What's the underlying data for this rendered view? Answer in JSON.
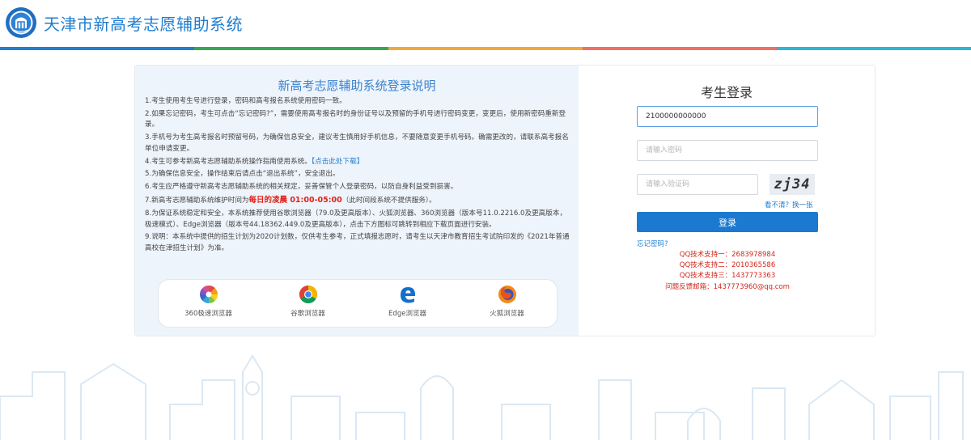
{
  "header": {
    "site_title": "天津市新高考志愿辅助系统",
    "stripe_colors": [
      "#1f7ed0",
      "#37a852",
      "#f0a93a",
      "#f26e63",
      "#2bb6d8"
    ]
  },
  "notice": {
    "title": "新高考志愿辅助系统登录说明",
    "items": [
      "1.考生使用考生号进行登录，密码和高考报名系统使用密码一致。",
      "2.如果忘记密码，考生可点击“忘记密码?”，需要使用高考报名时的身份证号以及预留的手机号进行密码变更，变更后，使用新密码重新登录。",
      "3.手机号为考生高考报名时预留号码，为确保信息安全，建议考生慎用好手机信息，不要随意变更手机号码。确需更改的，请联系高考报名单位申请变更。",
      "4.考生可参考新高考志愿辅助系统操作指南使用系统。",
      "5.为确保信息安全，操作结束后请点击“退出系统”，安全退出。",
      "6.考生应严格遵守新高考志愿辅助系统的相关规定，妥善保管个人登录密码，以防自身利益受到损害。",
      "7.新高考志愿辅助系统维护时间为",
      "8.为保证系统稳定和安全，本系统推荐使用谷歌浏览器（79.0及更高版本）、火狐浏览器、360浏览器（版本号11.0.2216.0及更高版本，极速模式）、Edge浏览器（版本号44.18362.449.0及更高版本），点击下方图标可跳转到相应下载页面进行安装。",
      "9.说明：本系统中提供的招生计划为2020计划数，仅供考生参考，正式填报志愿时，请考生以天津市教育招生考试院印发的《2021年普通高校在津招生计划》为准。"
    ],
    "guide_link": "【点击此处下载】",
    "maintenance_time": "每日的凌晨 01:00-05:00",
    "maintenance_note": "（此时间段系统不提供服务）。"
  },
  "browsers": [
    {
      "label": "360极速浏览器",
      "icon": "browser-360-icon"
    },
    {
      "label": "谷歌浏览器",
      "icon": "chrome-icon"
    },
    {
      "label": "Edge浏览器",
      "icon": "edge-icon"
    },
    {
      "label": "火狐浏览器",
      "icon": "firefox-icon"
    }
  ],
  "login": {
    "title": "考生登录",
    "username_value": "2100000000000",
    "password_placeholder": "请输入密码",
    "captcha_placeholder": "请输入验证码",
    "captcha_text": "zj34",
    "refresh_text": "看不清？换一张",
    "button_label": "登录",
    "forgot_text": "忘记密码?",
    "support": [
      "QQ技术支持一：2683978984",
      "QQ技术支持二：2010365586",
      "QQ技术支持三：1437773363",
      "问题反馈邮箱：1437773960@qq.com"
    ]
  }
}
